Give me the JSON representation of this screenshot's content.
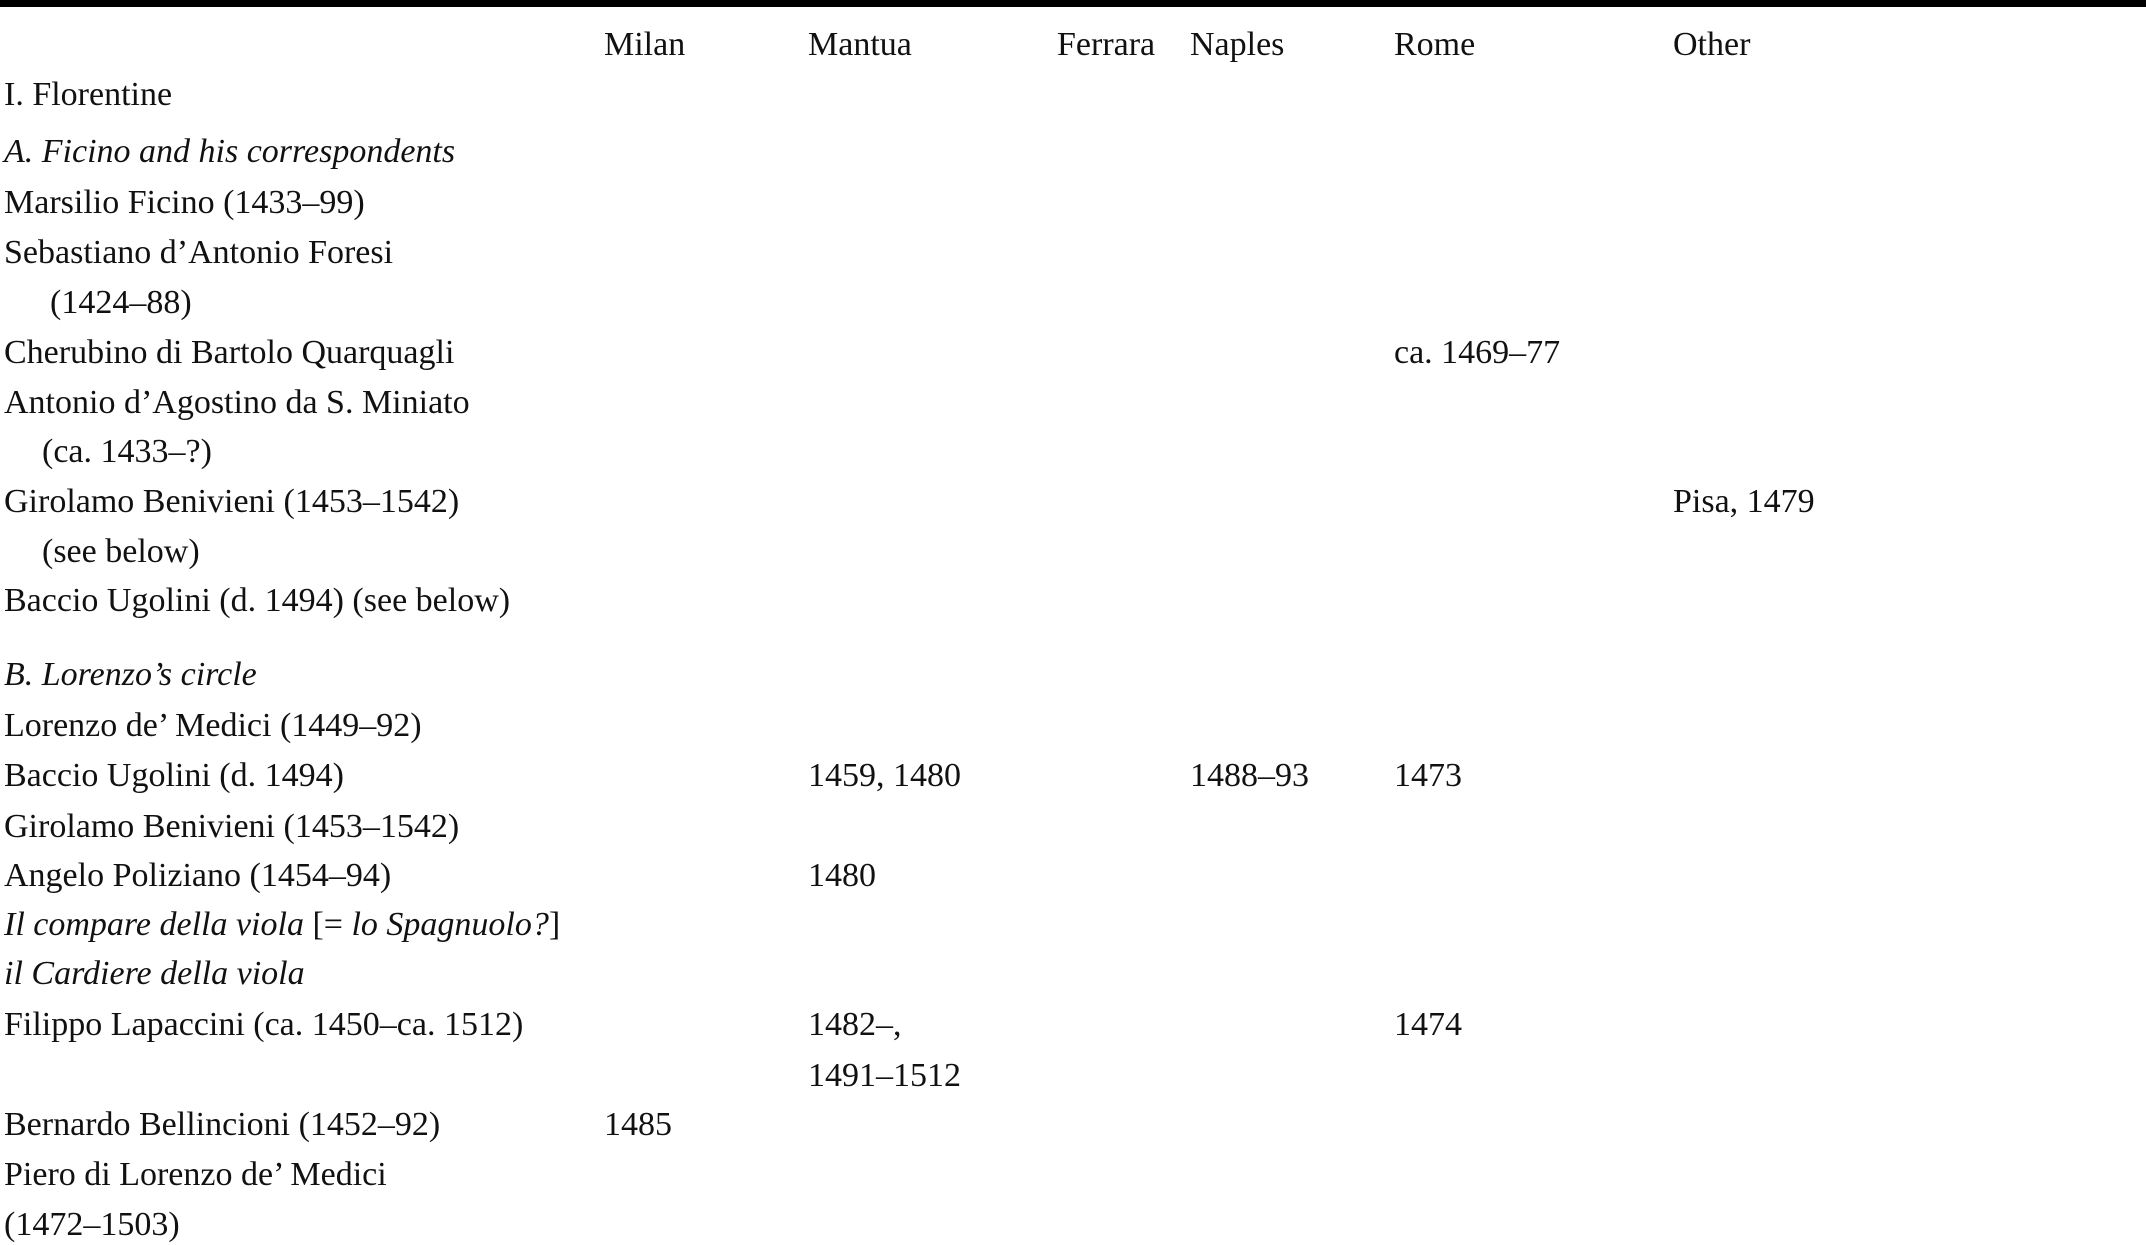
{
  "table": {
    "columns": [
      "Milan",
      "Mantua",
      "Ferrara",
      "Naples",
      "Rome",
      "Other"
    ],
    "section_title": "I. Florentine",
    "groups": [
      {
        "title": "A. Ficino and his correspondents",
        "rows": [
          {
            "name": [
              "Marsilio Ficino (1433–99)"
            ]
          },
          {
            "name": [
              "Sebastiano d’Antonio Foresi",
              "(1424–88)"
            ]
          },
          {
            "name": [
              "Cherubino di Bartolo Quarquagli"
            ],
            "rome": "ca. 1469–77"
          },
          {
            "name": [
              "Antonio d’Agostino da S. Miniato",
              "(ca. 1433–?)"
            ]
          },
          {
            "name": [
              "Girolamo Benivieni (1453–1542)",
              "(see below)"
            ],
            "other": "Pisa, 1479"
          },
          {
            "name": [
              "Baccio Ugolini (d. 1494) (see below)"
            ]
          }
        ]
      },
      {
        "title": "B. Lorenzo’s circle",
        "rows": [
          {
            "name": [
              "Lorenzo de’ Medici (1449–92)"
            ]
          },
          {
            "name": [
              "Baccio Ugolini (d. 1494)"
            ],
            "mantua": "1459, 1480",
            "naples": "1488–93",
            "rome": "1473"
          },
          {
            "name": [
              "Girolamo Benivieni (1453–1542)"
            ]
          },
          {
            "name": [
              "Angelo Poliziano (1454–94)"
            ],
            "mantua": "1480"
          },
          {
            "name_italic": "Il compare della viola",
            "name_rest": " [= ",
            "name_italic2": "lo Spagnuolo?",
            "name_end": "]"
          },
          {
            "name_italic_full": "il Cardiere della viola"
          },
          {
            "name": [
              "Filippo Lapaccini (ca. 1450–ca. 1512)"
            ],
            "mantua": [
              "1482–,",
              "1491–1512"
            ],
            "rome": "1474"
          },
          {
            "name": [
              "Bernardo Bellincioni (1452–92)"
            ],
            "milan": "1485"
          },
          {
            "name": [
              "Piero di Lorenzo de’ Medici",
              "(1472–1503)"
            ]
          }
        ]
      }
    ]
  }
}
